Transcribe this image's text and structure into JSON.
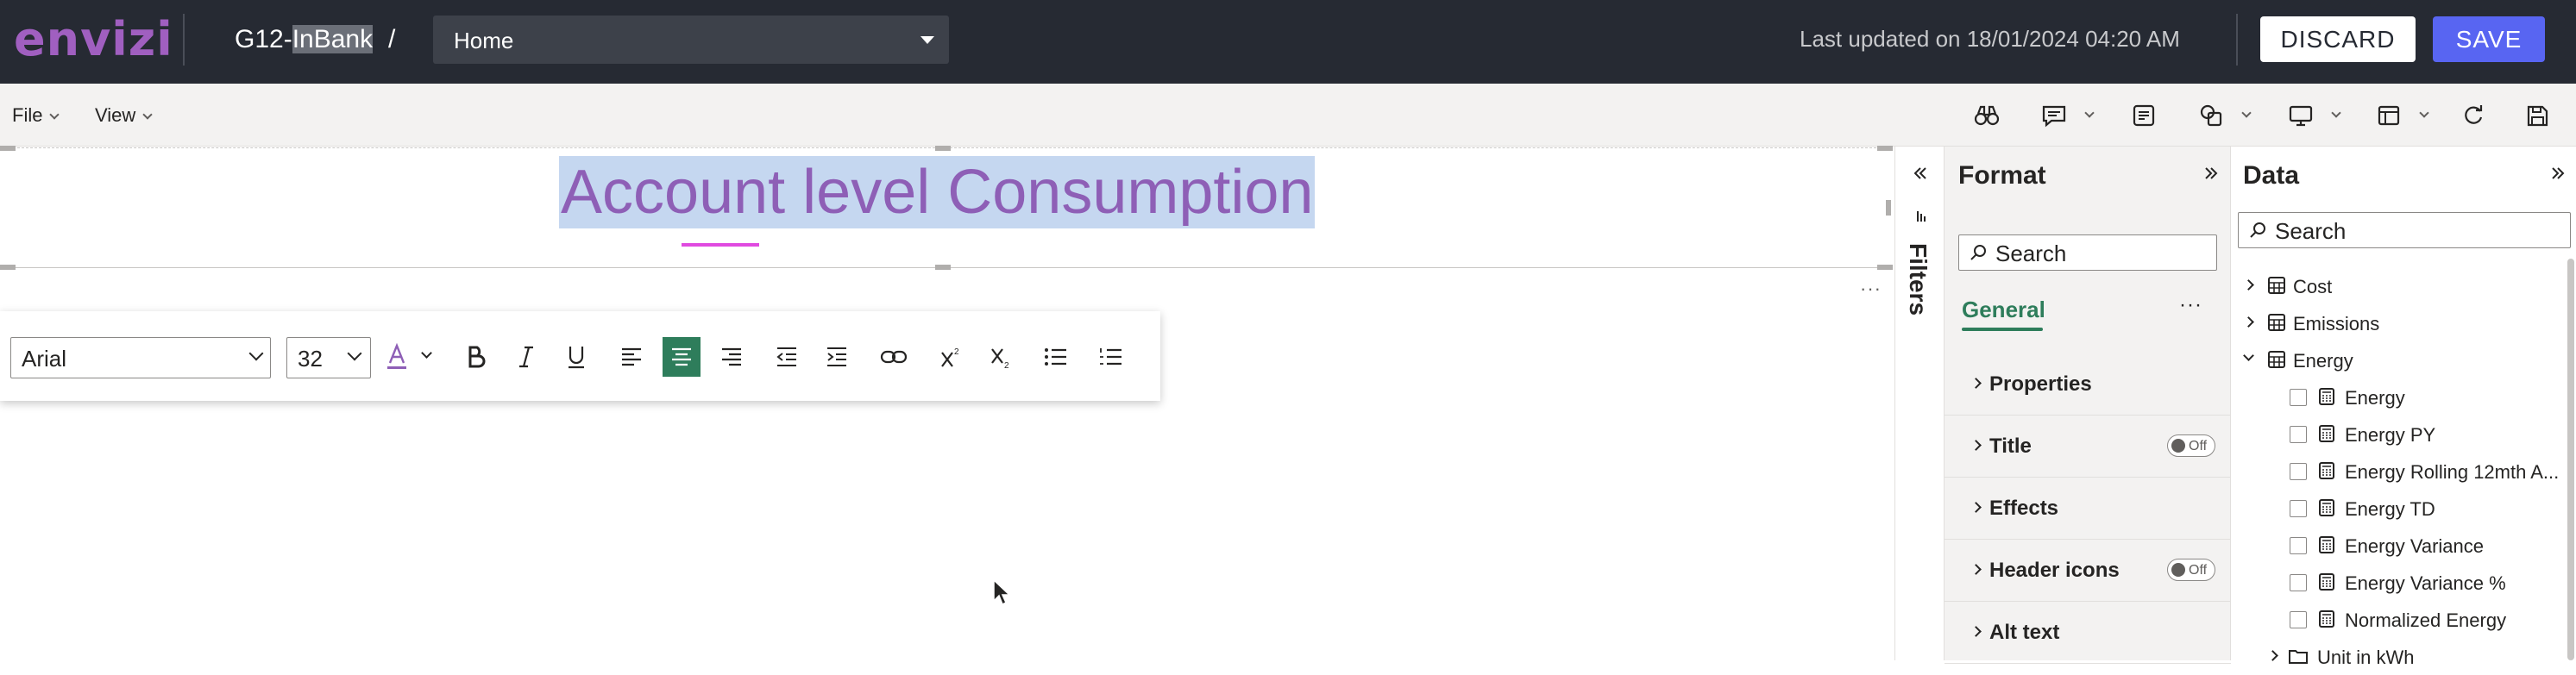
{
  "header": {
    "logo": "envizi",
    "report_prefix": "G12-",
    "report_highlight": "InBank",
    "breadcrumb_sep": "/",
    "page_select": "Home",
    "last_updated": "Last updated on 18/01/2024 04:20 AM",
    "discard_label": "DISCARD",
    "save_label": "SAVE"
  },
  "menubar": {
    "file_label": "File",
    "view_label": "View"
  },
  "canvas": {
    "title_text": "Account level Consumption",
    "more_label": "···"
  },
  "text_toolbar": {
    "font_family": "Arial",
    "font_size": "32"
  },
  "filters": {
    "label": "Filters"
  },
  "format_pane": {
    "title": "Format",
    "search_placeholder": "Search",
    "tab_general": "General",
    "more_label": "···",
    "sections": [
      {
        "label": "Properties",
        "toggle": null
      },
      {
        "label": "Title",
        "toggle": "Off"
      },
      {
        "label": "Effects",
        "toggle": null
      },
      {
        "label": "Header icons",
        "toggle": "Off"
      },
      {
        "label": "Alt text",
        "toggle": null
      }
    ]
  },
  "data_pane": {
    "title": "Data",
    "search_placeholder": "Search",
    "tables": [
      {
        "label": "Cost",
        "expanded": false
      },
      {
        "label": "Emissions",
        "expanded": false
      },
      {
        "label": "Energy",
        "expanded": true
      }
    ],
    "fields": [
      "Energy",
      "Energy PY",
      "Energy Rolling 12mth A...",
      "Energy TD",
      "Energy Variance",
      "Energy Variance %",
      "Normalized Energy"
    ],
    "folder": "Unit in kWh"
  },
  "colors": {
    "header_bg": "#262a33",
    "logo": "#a05fc0",
    "save_button": "#5865f2",
    "accent_green": "#2e7d5b",
    "title_text": "#8e5fb6",
    "title_selection": "#c5d7f0"
  }
}
